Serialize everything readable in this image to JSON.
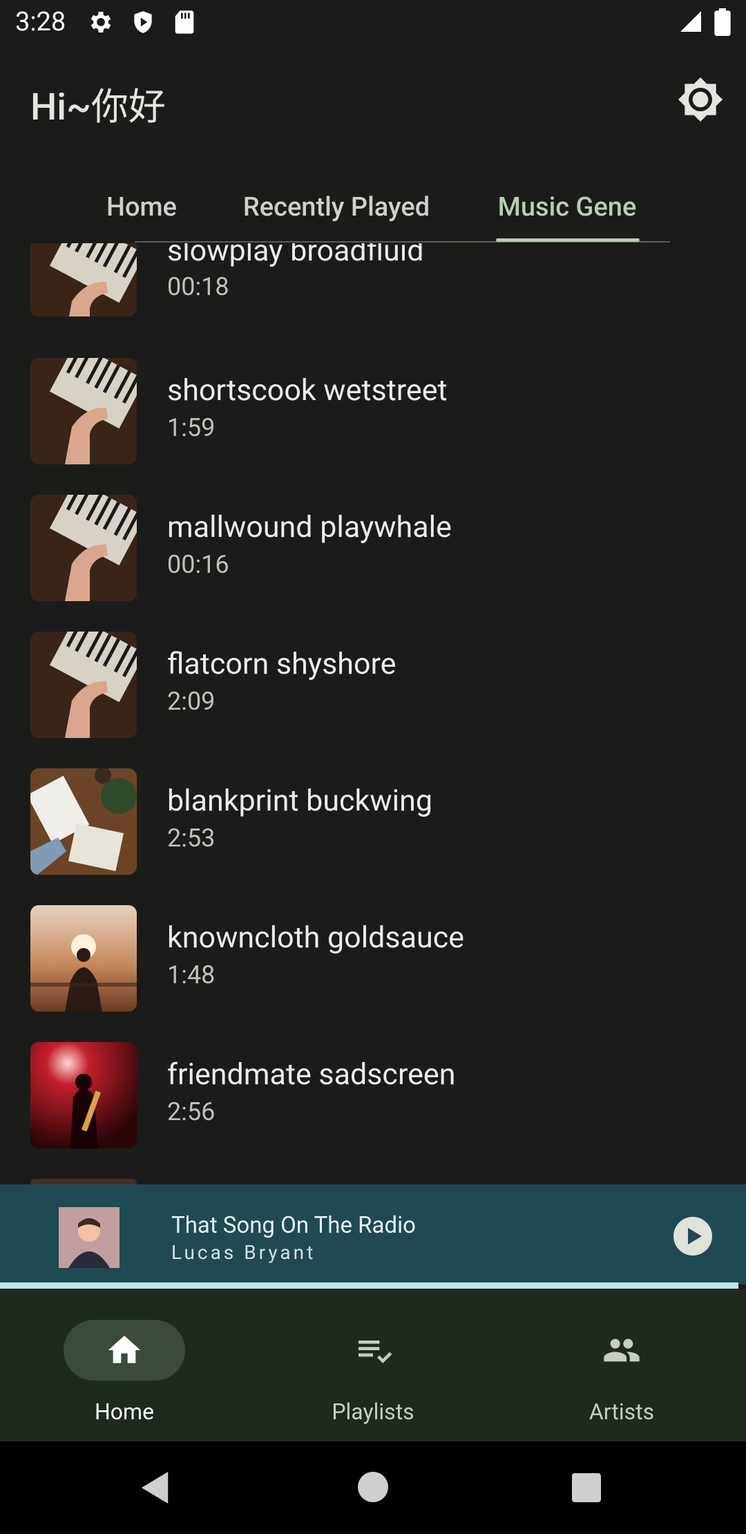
{
  "status_bar": {
    "time": "3:28",
    "icons": [
      "gear-icon",
      "shield-icon",
      "sd-card-icon",
      "signal-icon",
      "battery-icon"
    ]
  },
  "header": {
    "title": "Hi~你好",
    "theme_icon": "brightness-icon"
  },
  "tabs": [
    {
      "label": "Home",
      "active": false
    },
    {
      "label": "Recently Played",
      "active": false
    },
    {
      "label": "Music Gene",
      "active": true
    }
  ],
  "songs": [
    {
      "title": "slowplay broadfluid",
      "duration": "00:18",
      "art": "piano"
    },
    {
      "title": "shortscook wetstreet",
      "duration": "1:59",
      "art": "piano"
    },
    {
      "title": "mallwound playwhale",
      "duration": "00:16",
      "art": "piano"
    },
    {
      "title": "flatcorn shyshore",
      "duration": "2:09",
      "art": "piano"
    },
    {
      "title": "blankprint buckwing",
      "duration": "2:53",
      "art": "desk"
    },
    {
      "title": "knowncloth goldsauce",
      "duration": "1:48",
      "art": "sunset"
    },
    {
      "title": "friendmate sadscreen",
      "duration": "2:56",
      "art": "concert"
    }
  ],
  "mini_player": {
    "title": "That Song On The Radio",
    "artist": "Lucas Bryant",
    "play_icon": "play-icon",
    "progress": 0.99
  },
  "bottom_nav": [
    {
      "label": "Home",
      "icon": "home-icon",
      "active": true
    },
    {
      "label": "Playlists",
      "icon": "playlist-check-icon",
      "active": false
    },
    {
      "label": "Artists",
      "icon": "people-icon",
      "active": false
    }
  ],
  "colors": {
    "background": "#1b1c1a",
    "accent": "#b9cdb4",
    "mini_player_bg": "#1f4a52",
    "nav_bg": "#1f2a1f"
  }
}
